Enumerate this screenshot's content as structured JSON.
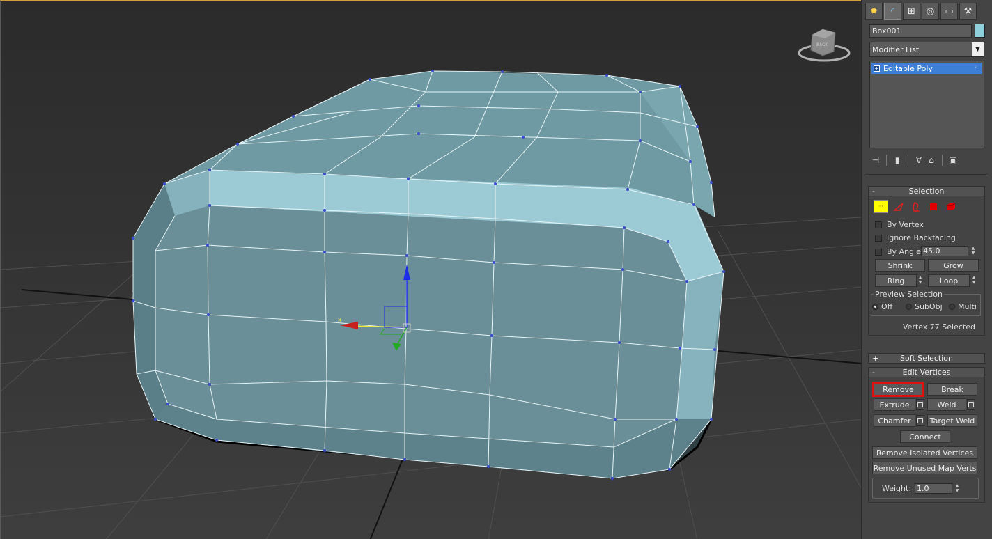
{
  "viewport": {
    "viewcube_label": "BACK",
    "gizmo_x_label": "x"
  },
  "panel": {
    "tabs": [
      {
        "name": "create-tab",
        "glyph": "✹"
      },
      {
        "name": "modify-tab",
        "glyph": "◜"
      },
      {
        "name": "hierarchy-tab",
        "glyph": "⊞"
      },
      {
        "name": "motion-tab",
        "glyph": "◎"
      },
      {
        "name": "display-tab",
        "glyph": "▭"
      },
      {
        "name": "utilities-tab",
        "glyph": "⚒"
      }
    ],
    "object_name": "Box001",
    "object_color": "#8fd0dc",
    "modifier_list": "Modifier List",
    "stack": {
      "item": "Editable Poly",
      "expand_glyph": "+",
      "dots": "⁖"
    },
    "stack_tools": [
      "pin-stack-icon",
      "show-end-result-icon",
      "make-unique-icon",
      "remove-modifier-icon",
      "configure-modifier-sets-icon"
    ],
    "selection": {
      "title": "Selection",
      "collapse": "-",
      "by_vertex": "By Vertex",
      "ignore_backfacing": "Ignore Backfacing",
      "by_angle": "By Angle:",
      "angle_value": "45.0",
      "shrink": "Shrink",
      "grow": "Grow",
      "ring": "Ring",
      "loop": "Loop",
      "preview_selection": "Preview Selection",
      "preview_off": "Off",
      "preview_subobj": "SubObj",
      "preview_multi": "Multi",
      "status": "Vertex 77 Selected"
    },
    "soft_selection": {
      "title": "Soft Selection",
      "expand": "+"
    },
    "edit_vertices": {
      "title": "Edit Vertices",
      "collapse": "-",
      "remove": "Remove",
      "break": "Break",
      "extrude": "Extrude",
      "weld": "Weld",
      "chamfer": "Chamfer",
      "target_weld": "Target Weld",
      "connect": "Connect",
      "remove_isolated": "Remove Isolated Vertices",
      "remove_unused_map": "Remove Unused Map Verts",
      "weight_label": "Weight:",
      "weight_value": "1.0"
    },
    "accent_color": "#3d7fd6",
    "highlight_color": "#e01010"
  }
}
